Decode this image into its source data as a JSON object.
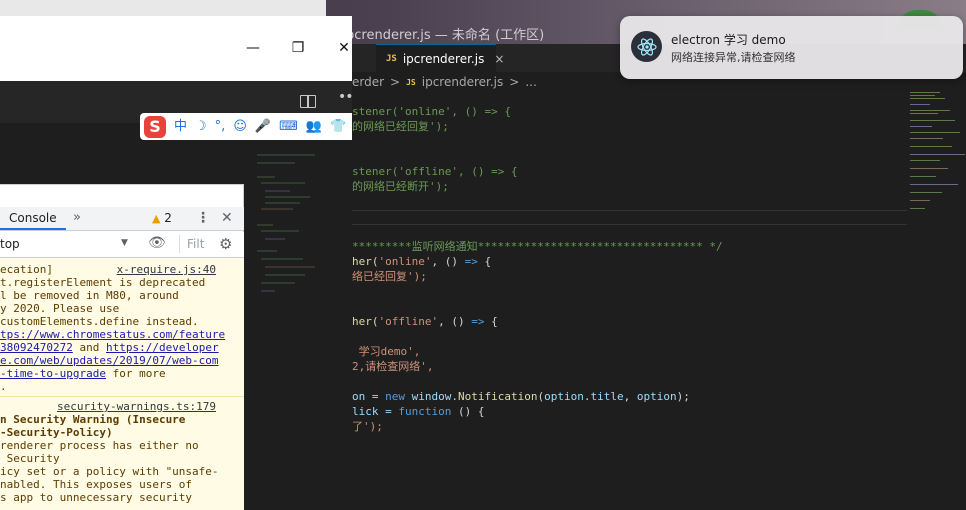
{
  "vscode": {
    "window_title": "pcrenderer.js — 未命名 (工作区)",
    "tab": {
      "badge": "JS",
      "label": "ipcrenderer.js",
      "close": "×"
    },
    "breadcrumb": {
      "part1": "erder",
      "sep1": ">",
      "badge": "JS",
      "file": "ipcrenderer.js",
      "sep2": ">",
      "rest": "..."
    },
    "code": {
      "l1a": "stener(",
      "l1b": "'online'",
      "l1c": ", () => {",
      "l2": "的网络已经回复');",
      "l3a": "stener(",
      "l3b": "'offline'",
      "l3c": ", () => {",
      "l4": "的网络已经断开');",
      "l5": "*********监听网络通知********************************** */",
      "l6a": "her(",
      "l6b": "'online'",
      "l6c": ", () ",
      "l6d": "=>",
      "l6e": " {",
      "l7": "络已经回复');",
      "l8a": "her(",
      "l8b": "'offline'",
      "l8c": ", () ",
      "l8d": "=>",
      "l8e": " {",
      "l9": " 学习demo',",
      "l10": "2,请检查网络',",
      "l11a": "on = ",
      "l11b": "new",
      "l11c": " window.",
      "l11d": "Notification",
      "l11e": "(",
      "l11f": "option",
      "l11g": ".",
      "l11h": "title",
      "l11i": ", ",
      "l11j": "option",
      "l11k": ");",
      "l12a": "lick = ",
      "l12b": "function",
      "l12c": " () {",
      "l13": "了');"
    }
  },
  "notification": {
    "title": "electron 学习 demo",
    "body": "网络连接异常,请检查网络"
  },
  "app_window": {
    "minimize": "—",
    "maximize": "❐",
    "close": "✕",
    "more": "••"
  },
  "ime": {
    "logo": "S",
    "items": [
      "中",
      "☽",
      "°,",
      "☺",
      "🎤",
      "⌨",
      "👥",
      "👕"
    ]
  },
  "devtools": {
    "console_tab": "Console",
    "more_tabs": "»",
    "warning_count": "2",
    "warning_icon": "▲",
    "kebab": "⋮",
    "close": "✕",
    "context": "top",
    "context_arrow": "▼",
    "eye": "👁",
    "filter_placeholder": "Filt",
    "gear": "⚙",
    "msg1": {
      "source": "x-require.js:40",
      "lines": [
        "ecation]",
        "t.registerElement is deprecated",
        "l be removed in M80, around",
        "y 2020. Please use",
        "customElements.define instead.",
        "tps://www.chromestatus.com/feature",
        "38092470272",
        "e.com/web/updates/2019/07/web-com",
        "-time-to-upgrade",
        "."
      ],
      "and": " and ",
      "link2": "https://developer",
      "formore": " for more"
    },
    "msg2": {
      "source": "security-warnings.ts:179",
      "lines": [
        "n Security Warning (Insecure",
        "-Security-Policy)",
        "renderer process has either no",
        " Security",
        "icy set or a policy with \"unsafe-",
        "nabled. This exposes users of",
        "s app to unnecessary security"
      ]
    }
  }
}
